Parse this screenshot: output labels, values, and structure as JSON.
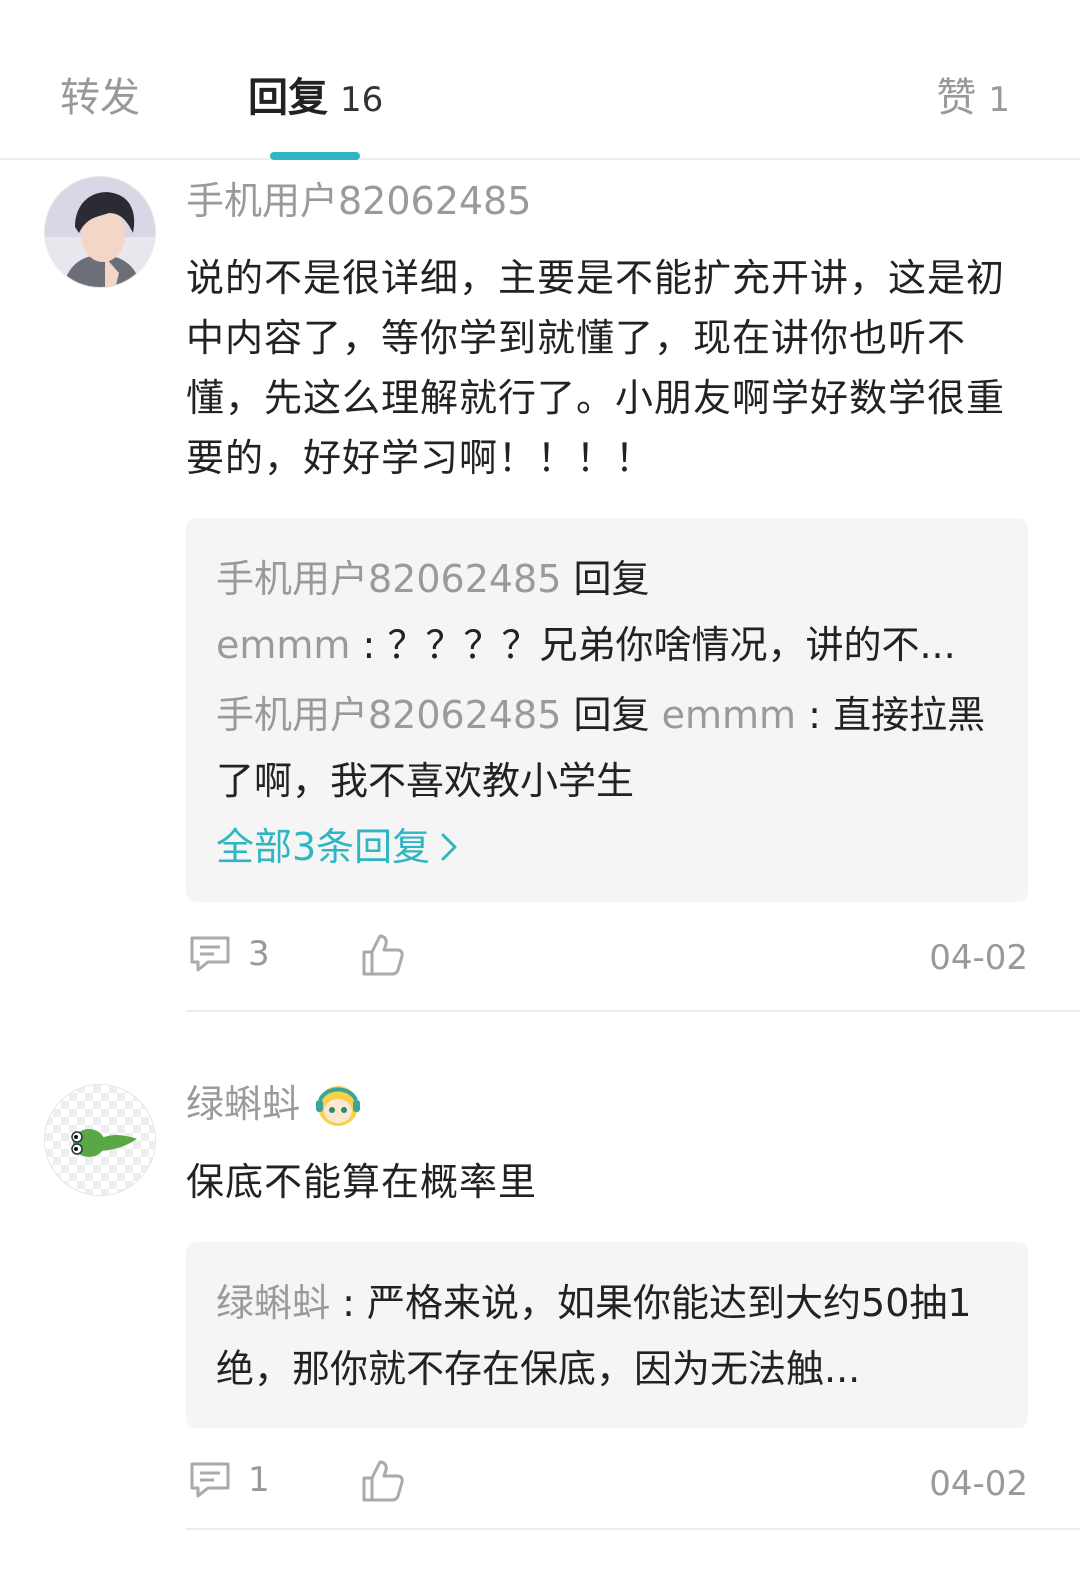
{
  "tabs": {
    "forward": {
      "label": "转发"
    },
    "reply": {
      "label": "回复",
      "count": "16"
    },
    "like": {
      "label": "赞",
      "count": "1"
    }
  },
  "comments": [
    {
      "username": "手机用户82062485",
      "text": "说的不是很详细，主要是不能扩充开讲，这是初中内容了，等你学到就懂了，现在讲你也听不懂，先这么理解就行了。小朋友啊学好数学很重要的，好好学习啊！！！！",
      "replies": {
        "r1_user": "手机用户82062485",
        "r1_verb": "回复",
        "r1_target": "emmm",
        "r1_colon": ":",
        "r1_text": "？？？？兄弟你啥情况，讲的不...",
        "r2_user": "手机用户82062485",
        "r2_verb": "回复",
        "r2_target": "emmm",
        "r2_colon": ":",
        "r2_text": "直接拉黑了啊，我不喜欢教小学生"
      },
      "more_label": "全部3条回复",
      "reply_count": "3",
      "date": "04-02"
    },
    {
      "username": "绿蝌蚪",
      "text": "保底不能算在概率里",
      "replies": {
        "r1_user": "绿蝌蚪",
        "r1_colon": ":",
        "r1_text": "严格来说，如果你能达到大约50抽1绝，那你就不存在保底，因为无法触..."
      },
      "reply_count": "1",
      "date": "04-02"
    }
  ],
  "colors": {
    "accent": "#2fb6c2",
    "muted": "#999999",
    "reply_bg": "#f5f5f5"
  },
  "icons": [
    "comment-icon",
    "thumbs-up-icon",
    "chevron-right-icon",
    "avatar-badge-icon"
  ]
}
